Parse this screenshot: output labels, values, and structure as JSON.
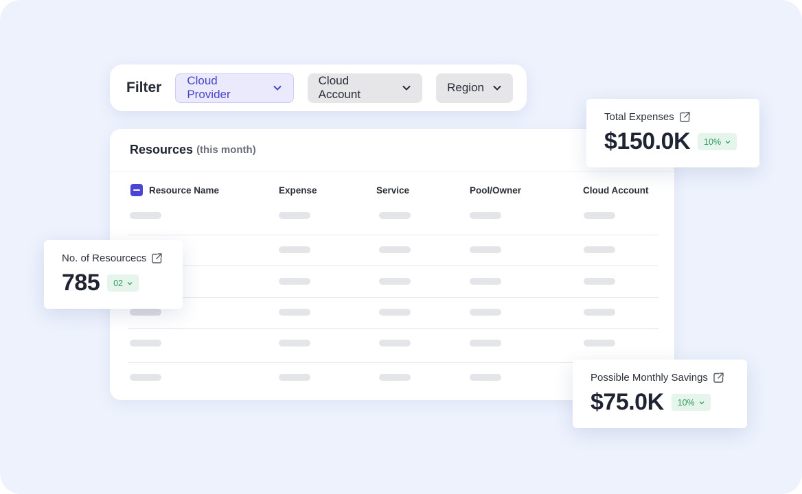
{
  "filter": {
    "label": "Filter",
    "dropdowns": [
      {
        "label": "Cloud Provider",
        "active": true
      },
      {
        "label": "Cloud Account",
        "active": false
      },
      {
        "label": "Region",
        "active": false
      }
    ]
  },
  "resources": {
    "title": "Resources",
    "subtitle": "(this month)",
    "columns": [
      "Resource Name",
      "Expense",
      "Service",
      "Pool/Owner",
      "Cloud Account"
    ]
  },
  "stats": {
    "total_expenses": {
      "label": "Total Expenses",
      "value": "$150.0K",
      "badge": "10%"
    },
    "resources_count": {
      "label": "No. of Resourcecs",
      "value": "785",
      "badge": "02"
    },
    "savings": {
      "label": "Possible Monthly Savings",
      "value": "$75.0K",
      "badge": "10%"
    }
  },
  "colors": {
    "background": "#edf2fd",
    "accent": "#4a45d6",
    "badge_text": "#2f9a5c",
    "badge_bg": "#e6f5ec"
  }
}
